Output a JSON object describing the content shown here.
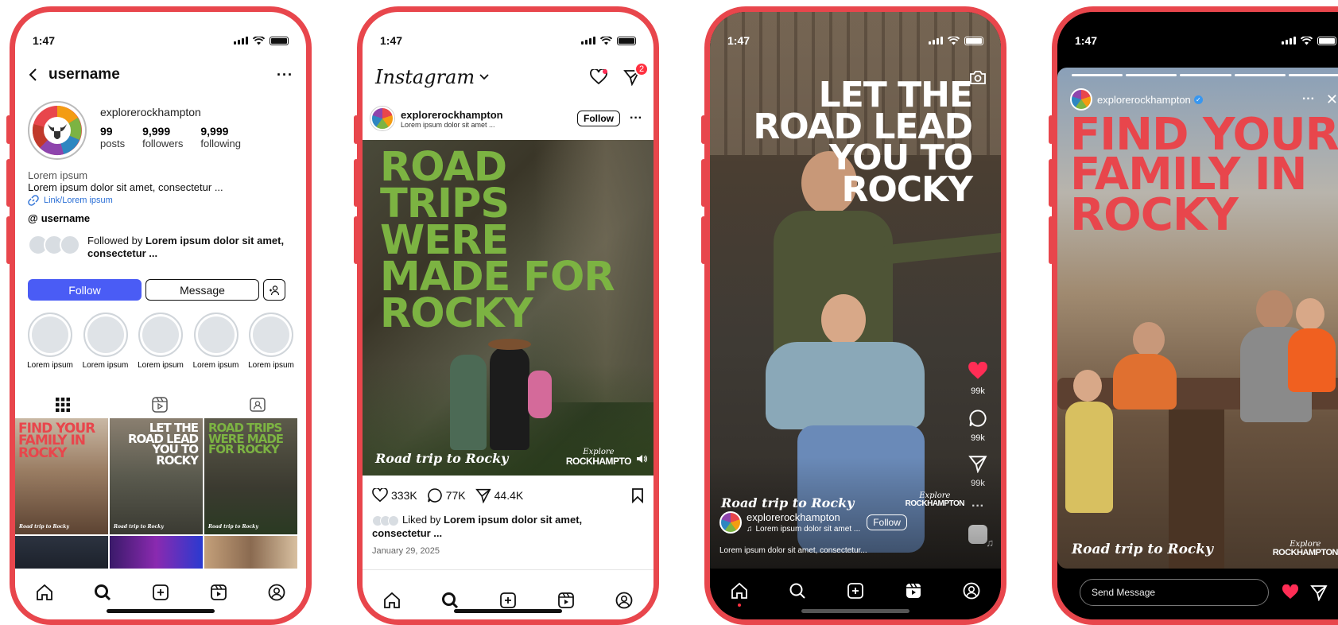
{
  "status": {
    "time": "1:47"
  },
  "profile": {
    "header_username": "username",
    "display_name": "explorerockhampton",
    "stats": [
      {
        "value": "99",
        "label": "posts"
      },
      {
        "value": "9,999",
        "label": "followers"
      },
      {
        "value": "9,999",
        "label": "following"
      }
    ],
    "bio_name": "Lorem ipsum",
    "bio_text": "Lorem ipsum dolor sit amet, consectetur  ...",
    "link": "Link/Lorem ipsum",
    "threads_handle": "username",
    "followed_by_prefix": "Followed by ",
    "followed_by_names": "Lorem ipsum dolor sit amet, consectetur  ...",
    "follow_label": "Follow",
    "message_label": "Message",
    "highlights": [
      "Lorem ipsum",
      "Lorem ipsum",
      "Lorem ipsum",
      "Lorem ipsum",
      "Lorem ipsum"
    ],
    "grid": [
      {
        "headline": "FIND YOUR FAMILY IN ROCKY",
        "caption": "Road trip to Rocky",
        "color": "#e8464c"
      },
      {
        "headline": "LET THE ROAD LEAD YOU TO ROCKY",
        "caption": "Road trip to Rocky",
        "color": "#ffffff"
      },
      {
        "headline": "ROAD TRIPS WERE MADE FOR ROCKY",
        "caption": "Road trip to Rocky",
        "color": "#7cb342"
      }
    ]
  },
  "feed": {
    "logo": "Instagram",
    "badge_count": "2",
    "username": "explorerockhampton",
    "subtitle": "Lorem ipsum dolor sit amet ...",
    "follow_label": "Follow",
    "headline": "ROAD TRIPS WERE MADE FOR ROCKY",
    "headline_lines": [
      "ROAD",
      "TRIPS",
      "WERE",
      "MADE FOR",
      "ROCKY"
    ],
    "caption_script": "Road trip to Rocky",
    "brand_small": "Explore",
    "brand_big": "ROCKHAMPTO",
    "likes": "333K",
    "comments": "77K",
    "shares": "44.4K",
    "liked_by_prefix": "Liked by ",
    "liked_by_names": "Lorem ipsum dolor sit amet, consectetur  ...",
    "date": "January 29, 2025"
  },
  "reel": {
    "headline_lines": [
      "LET THE",
      "ROAD LEAD",
      "YOU TO",
      "ROCKY"
    ],
    "likes": "99k",
    "comments": "99k",
    "shares": "99k",
    "caption_script": "Road trip to Rocky",
    "brand_small": "Explore",
    "brand_big": "ROCKHAMPTON",
    "username": "explorerockhampton",
    "audio": "Lorem ipsum dolor sit amet ...",
    "follow_label": "Follow",
    "description": "Lorem ipsum dolor sit amet, consectetur..."
  },
  "story": {
    "username": "explorerockhampton",
    "headline_lines": [
      "FIND YOUR",
      "FAMILY IN",
      "ROCKY"
    ],
    "caption_script": "Road trip to Rocky",
    "brand_small": "Explore",
    "brand_big": "ROCKHAMPTON",
    "send_placeholder": "Send Message"
  },
  "colors": {
    "frame": "#e8464c",
    "accent_green": "#7cb342",
    "accent_red": "#e8464c",
    "follow_blue": "#4a5cf5",
    "like_pink": "#ff2d55"
  }
}
